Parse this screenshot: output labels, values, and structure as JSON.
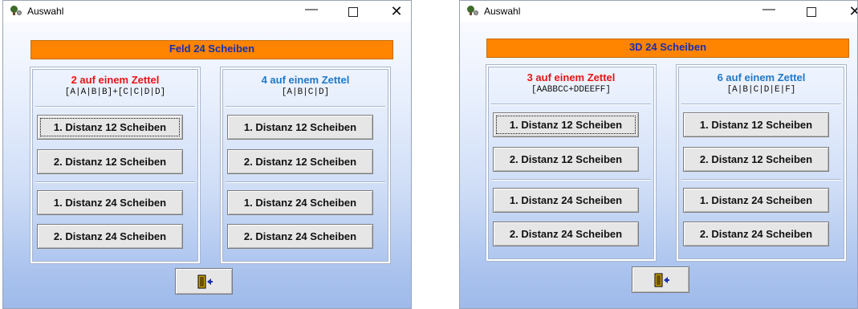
{
  "windows": [
    {
      "title": "Auswahl",
      "banner": "Feld 24 Scheiben",
      "groups": [
        {
          "title": "2 auf einem Zettel",
          "pattern": "[A|A|B|B]+[C|C|D|D]",
          "buttons": [
            "1. Distanz 12 Scheiben",
            "2. Distanz 12 Scheiben",
            "1. Distanz 24 Scheiben",
            "2. Distanz 24 Scheiben"
          ]
        },
        {
          "title": "4 auf einem Zettel",
          "pattern": "[A|B|C|D]",
          "buttons": [
            "1. Distanz 12 Scheiben",
            "2. Distanz 12 Scheiben",
            "1. Distanz 24 Scheiben",
            "2. Distanz 24 Scheiben"
          ]
        }
      ]
    },
    {
      "title": "Auswahl",
      "banner": "3D 24 Scheiben",
      "groups": [
        {
          "title": "3 auf einem Zettel",
          "pattern": "[AABBCC+DDEEFF]",
          "buttons": [
            "1. Distanz 12 Scheiben",
            "2. Distanz 12 Scheiben",
            "1. Distanz 24 Scheiben",
            "2. Distanz 24 Scheiben"
          ]
        },
        {
          "title": "6 auf einem Zettel",
          "pattern": "[A|B|C|D|E|F]",
          "buttons": [
            "1. Distanz 12 Scheiben",
            "2. Distanz 12 Scheiben",
            "1. Distanz 24 Scheiben",
            "2. Distanz 24 Scheiben"
          ]
        }
      ]
    }
  ],
  "icons": {
    "window_icon": "tree-target-icon",
    "exit_icon": "exit-door-icon"
  },
  "colors": {
    "banner": "#ff8400",
    "banner_text": "#1a2fb0",
    "title_red": "#e81414",
    "title_blue": "#1f78c8"
  }
}
